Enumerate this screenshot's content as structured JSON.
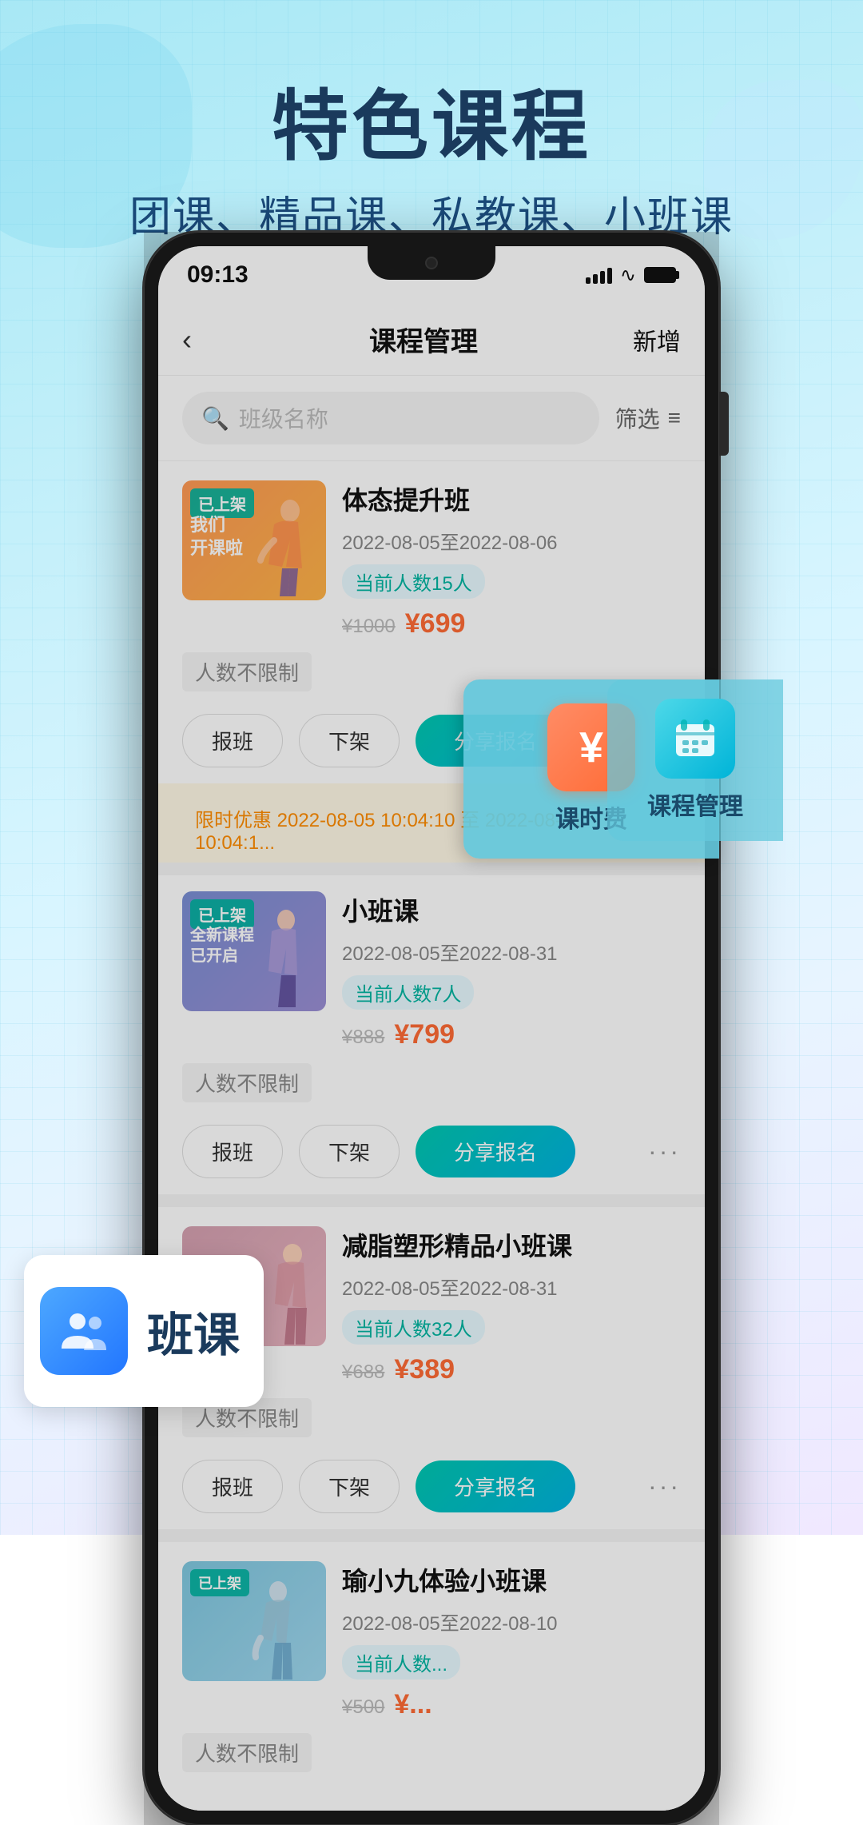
{
  "page": {
    "background": {
      "mainTitle": "特色课程",
      "subTitle": "团课、精品课、私教课、小班课"
    },
    "statusBar": {
      "time": "09:13"
    },
    "navbar": {
      "back": "‹",
      "title": "课程管理",
      "action": "新增"
    },
    "search": {
      "placeholder": "班级名称",
      "filterLabel": "筛选"
    },
    "courses": [
      {
        "id": 1,
        "name": "体态提升班",
        "badgeOnline": "已上架",
        "badgeText": "我们\n开课啦",
        "dateRange": "2022-08-05至2022-08-06",
        "students": "当前人数15人",
        "capacity": "人数不限制",
        "priceOriginal": "¥1000",
        "priceCurrent": "¥699",
        "priceCurrentNum": "699",
        "priceOriginalNum": "1000",
        "btnRegister": "报班",
        "btnOffline": "下架",
        "btnShare": "分享报名",
        "imgBg": "img-bg-1"
      },
      {
        "id": 2,
        "name": "小班课",
        "badgeOnline": "已上架",
        "badgeText": "全新课程\n已开启",
        "dateRange": "2022-08-05至2022-08-31",
        "students": "当前人数7人",
        "capacity": "人数不限制",
        "priceOriginal": "¥888",
        "priceCurrent": "¥799",
        "priceCurrentNum": "799",
        "priceOriginalNum": "888",
        "btnRegister": "报班",
        "btnOffline": "下架",
        "btnShare": "分享报名",
        "imgBg": "img-bg-2",
        "promo": "限时优惠 2022-08-05 10:04:10 至 2022-08-31 10:04:1..."
      },
      {
        "id": 3,
        "name": "减脂塑形精品小班课",
        "badgeOnline": "",
        "dateRange": "2022-08-05至2022-08-31",
        "students": "当前人数32人",
        "capacity": "人数不限制",
        "priceOriginal": "¥688",
        "priceCurrent": "¥389",
        "priceCurrentNum": "389",
        "priceOriginalNum": "688",
        "btnRegister": "报班",
        "btnOffline": "下架",
        "btnShare": "分享报名",
        "imgBg": "img-bg-3"
      },
      {
        "id": 4,
        "name": "瑜小九体验小班课",
        "badgeOnline": "已上架",
        "dateRange": "2022-08-05至2022-08-10",
        "students": "当前人数...",
        "capacity": "人数不限制",
        "priceOriginal": "¥500",
        "priceCurrent": "¥...",
        "imgBg": "img-bg-4"
      }
    ],
    "popup": {
      "label1": "课时费",
      "label2": "课程管理"
    },
    "floatBadge": {
      "text": "班课"
    }
  }
}
